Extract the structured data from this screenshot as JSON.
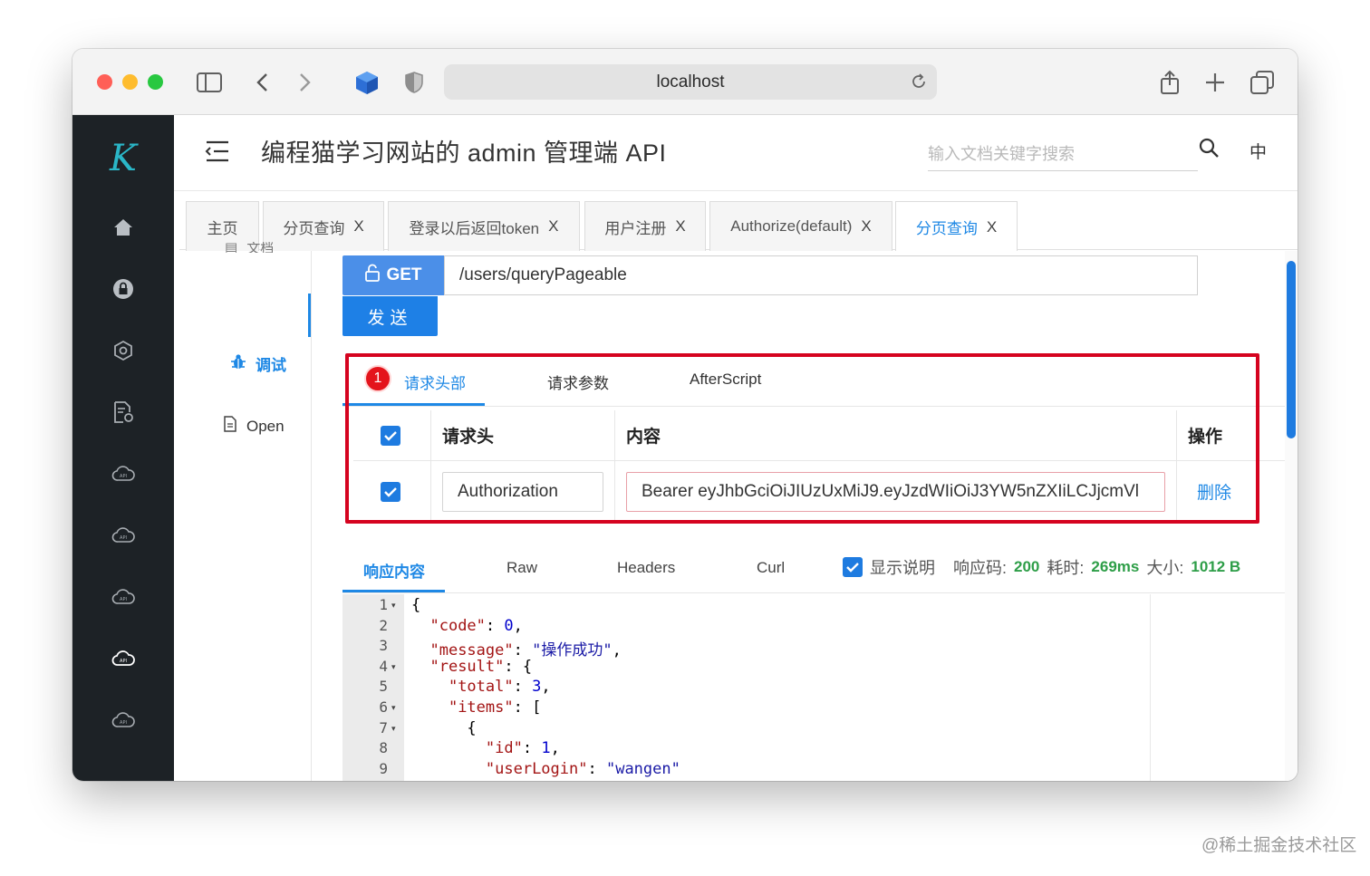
{
  "browser": {
    "url": "localhost",
    "colors": {
      "close": "#ff5f57",
      "minimize": "#febc2e",
      "zoom": "#28c840"
    }
  },
  "app": {
    "logo": "K",
    "title": "编程猫学习网站的 admin 管理端 API",
    "search_placeholder": "输入文档关键字搜索",
    "lang": "中",
    "accent": "#1e88e5"
  },
  "tabs": [
    {
      "label": "主页",
      "closable": false
    },
    {
      "label": "分页查询",
      "closable": true
    },
    {
      "label": "登录以后返回token",
      "closable": true
    },
    {
      "label": "用户注册",
      "closable": true
    },
    {
      "label": "Authorize(default)",
      "closable": true
    },
    {
      "label": "分页查询",
      "closable": true,
      "active": true
    }
  ],
  "close_glyph": "X",
  "subnav": {
    "partial_top": "文档",
    "debug": "调试",
    "open": "Open"
  },
  "request": {
    "method": "GET",
    "path": "/users/queryPageable",
    "send": "发送"
  },
  "req_tabs": {
    "badge": "1",
    "headers": "请求头部",
    "params": "请求参数",
    "afterscript": "AfterScript"
  },
  "header_table": {
    "col_header": "请求头",
    "col_content": "内容",
    "col_action": "操作",
    "rows": [
      {
        "name": "Authorization",
        "value": "Bearer eyJhbGciOiJIUzUxMiJ9.eyJzdWIiOiJ3YW5nZXIiLCJjcmVl",
        "action": "删除"
      }
    ]
  },
  "response": {
    "tabs": [
      "响应内容",
      "Raw",
      "Headers",
      "Curl"
    ],
    "show_desc": "显示说明",
    "code_label": "响应码:",
    "code_value": "200",
    "time_label": "耗时:",
    "time_value": "269ms",
    "size_label": "大小:",
    "size_value": "1012 B"
  },
  "code_lines": [
    {
      "n": "1",
      "fold": true,
      "text": "{"
    },
    {
      "n": "2",
      "fold": false,
      "text": "  \"code\": 0,"
    },
    {
      "n": "3",
      "fold": false,
      "text": "  \"message\": \"操作成功\","
    },
    {
      "n": "4",
      "fold": true,
      "text": "  \"result\": {"
    },
    {
      "n": "5",
      "fold": false,
      "text": "    \"total\": 3,"
    },
    {
      "n": "6",
      "fold": true,
      "text": "    \"items\": ["
    },
    {
      "n": "7",
      "fold": true,
      "text": "      {"
    },
    {
      "n": "8",
      "fold": false,
      "text": "        \"id\": 1,"
    },
    {
      "n": "9",
      "fold": false,
      "text": "        \"userLogin\": \"wangen\""
    }
  ],
  "watermark": "@稀土掘金技术社区"
}
